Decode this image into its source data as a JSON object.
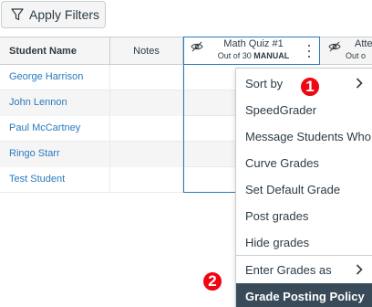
{
  "toolbar": {
    "apply_filters_label": "Apply Filters"
  },
  "grid": {
    "headers": {
      "student": "Student Name",
      "notes": "Notes",
      "quiz_title": "Math Quiz #1",
      "quiz_sub_prefix": "Out of 30",
      "quiz_sub_status": "MANUAL",
      "next_title": "Atte",
      "next_sub": "Out o"
    },
    "students": [
      "George Harrison",
      "John Lennon",
      "Paul McCartney",
      "Ringo Starr",
      "Test Student"
    ]
  },
  "menu": {
    "items": [
      {
        "label": "Sort by",
        "submenu": true
      },
      {
        "label": "SpeedGrader"
      },
      {
        "label": "Message Students Who"
      },
      {
        "label": "Curve Grades"
      },
      {
        "label": "Set Default Grade"
      },
      {
        "label": "Post grades"
      },
      {
        "label": "Hide grades"
      },
      {
        "label": "Enter Grades as",
        "submenu": true
      },
      {
        "label": "Grade Posting Policy",
        "active": true
      }
    ]
  },
  "callouts": {
    "one": "1",
    "two": "2"
  },
  "colors": {
    "accent": "#2b7abc",
    "badge": "#ee0612",
    "active_item": "#394b58"
  }
}
